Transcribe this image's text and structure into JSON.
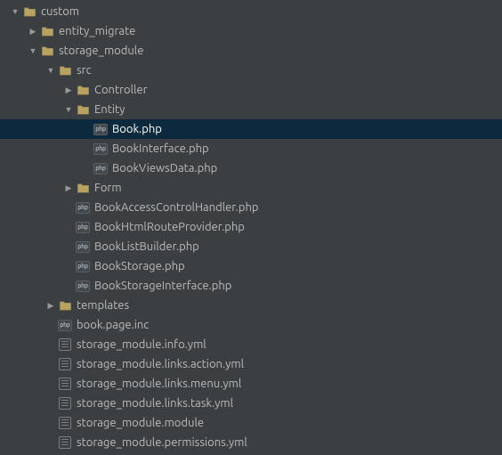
{
  "tree": [
    {
      "depth": 0,
      "arrow": "down",
      "icon": "folder",
      "label": "custom",
      "interact": true,
      "sel": false
    },
    {
      "depth": 1,
      "arrow": "right",
      "icon": "folder",
      "label": "entity_migrate",
      "interact": true,
      "sel": false
    },
    {
      "depth": 1,
      "arrow": "down",
      "icon": "folder",
      "label": "storage_module",
      "interact": true,
      "sel": false
    },
    {
      "depth": 2,
      "arrow": "down",
      "icon": "folder",
      "label": "src",
      "interact": true,
      "sel": false
    },
    {
      "depth": 3,
      "arrow": "right",
      "icon": "folder",
      "label": "Controller",
      "interact": true,
      "sel": false
    },
    {
      "depth": 3,
      "arrow": "down",
      "icon": "folder",
      "label": "Entity",
      "interact": true,
      "sel": false
    },
    {
      "depth": 4,
      "arrow": "none",
      "icon": "php",
      "label": "Book.php",
      "interact": true,
      "sel": true
    },
    {
      "depth": 4,
      "arrow": "none",
      "icon": "php",
      "label": "BookInterface.php",
      "interact": true,
      "sel": false
    },
    {
      "depth": 4,
      "arrow": "none",
      "icon": "php",
      "label": "BookViewsData.php",
      "interact": true,
      "sel": false
    },
    {
      "depth": 3,
      "arrow": "right",
      "icon": "folder",
      "label": "Form",
      "interact": true,
      "sel": false
    },
    {
      "depth": 3,
      "arrow": "none",
      "icon": "php",
      "label": "BookAccessControlHandler.php",
      "interact": true,
      "sel": false
    },
    {
      "depth": 3,
      "arrow": "none",
      "icon": "php",
      "label": "BookHtmlRouteProvider.php",
      "interact": true,
      "sel": false
    },
    {
      "depth": 3,
      "arrow": "none",
      "icon": "php",
      "label": "BookListBuilder.php",
      "interact": true,
      "sel": false
    },
    {
      "depth": 3,
      "arrow": "none",
      "icon": "php",
      "label": "BookStorage.php",
      "interact": true,
      "sel": false
    },
    {
      "depth": 3,
      "arrow": "none",
      "icon": "php",
      "label": "BookStorageInterface.php",
      "interact": true,
      "sel": false
    },
    {
      "depth": 2,
      "arrow": "right",
      "icon": "folder",
      "label": "templates",
      "interact": true,
      "sel": false
    },
    {
      "depth": 2,
      "arrow": "none",
      "icon": "php",
      "label": "book.page.inc",
      "interact": true,
      "sel": false
    },
    {
      "depth": 2,
      "arrow": "none",
      "icon": "yml",
      "label": "storage_module.info.yml",
      "interact": true,
      "sel": false
    },
    {
      "depth": 2,
      "arrow": "none",
      "icon": "yml",
      "label": "storage_module.links.action.yml",
      "interact": true,
      "sel": false
    },
    {
      "depth": 2,
      "arrow": "none",
      "icon": "yml",
      "label": "storage_module.links.menu.yml",
      "interact": true,
      "sel": false
    },
    {
      "depth": 2,
      "arrow": "none",
      "icon": "yml",
      "label": "storage_module.links.task.yml",
      "interact": true,
      "sel": false
    },
    {
      "depth": 2,
      "arrow": "none",
      "icon": "yml",
      "label": "storage_module.module",
      "interact": true,
      "sel": false
    },
    {
      "depth": 2,
      "arrow": "none",
      "icon": "yml",
      "label": "storage_module.permissions.yml",
      "interact": true,
      "sel": false
    }
  ],
  "indent": {
    "base": 12,
    "step": 20
  },
  "glyphs": {
    "right": "▶",
    "down": "▼",
    "php": "php"
  }
}
